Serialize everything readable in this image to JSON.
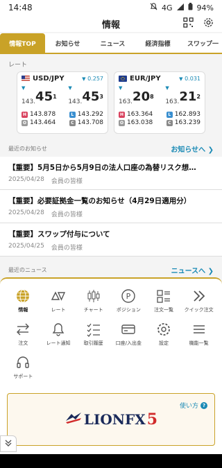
{
  "status": {
    "time": "14:48",
    "network": "4G",
    "battery": "94%"
  },
  "header": {
    "title": "情報"
  },
  "tabs": [
    {
      "label": "情報TOP",
      "active": true
    },
    {
      "label": "お知らせ"
    },
    {
      "label": "ニュース"
    },
    {
      "label": "経済指標"
    },
    {
      "label": "スワップ一"
    }
  ],
  "rates_section": {
    "label": "レート"
  },
  "rates": [
    {
      "pair": "USD/JPY",
      "change": "0.257",
      "bid": {
        "small": "143.",
        "big": "45",
        "sup": "1"
      },
      "ask": {
        "small": "143.",
        "big": "45",
        "sup": "3"
      },
      "high": "143.878",
      "low": "143.292",
      "open": "143.464",
      "close": "143.708"
    },
    {
      "pair": "EUR/JPY",
      "change": "0.031",
      "bid": {
        "small": "163.",
        "big": "20",
        "sup": "8"
      },
      "ask": {
        "small": "163.",
        "big": "21",
        "sup": "2"
      },
      "high": "163.364",
      "low": "162.893",
      "open": "163.038",
      "close": "163.239"
    }
  ],
  "notices": {
    "label": "最近のお知らせ",
    "link": "お知らせへ ❯",
    "items": [
      {
        "title": "【重要】5月5日から5月9日の法人口座の為替リスク想…",
        "date": "2025/04/28",
        "audience": "会員の皆様"
      },
      {
        "title": "【重要】必要証拠金一覧のお知らせ（4月29日適用分）",
        "date": "2025/04/28",
        "audience": "会員の皆様"
      },
      {
        "title": "【重要】スワップ付与について",
        "date": "2025/04/25",
        "audience": "会員の皆様"
      }
    ]
  },
  "news": {
    "label": "最近のニュース",
    "link": "ニュースへ ❯"
  },
  "menu": [
    {
      "label": "情報",
      "icon": "globe-icon",
      "active": true
    },
    {
      "label": "レート",
      "icon": "rate-triangles-icon"
    },
    {
      "label": "チャート",
      "icon": "candlestick-icon"
    },
    {
      "label": "ポジション",
      "icon": "position-p-icon"
    },
    {
      "label": "注文一覧",
      "icon": "order-list-icon"
    },
    {
      "label": "クイック注文",
      "icon": "double-chevron-icon"
    },
    {
      "label": "注文",
      "icon": "exchange-arrows-icon"
    },
    {
      "label": "レート通知",
      "icon": "bell-icon"
    },
    {
      "label": "取引履歴",
      "icon": "checklist-icon"
    },
    {
      "label": "口座/入出金",
      "icon": "card-icon"
    },
    {
      "label": "設定",
      "icon": "gear-icon"
    },
    {
      "label": "機能一覧",
      "icon": "menu-icon"
    },
    {
      "label": "サポート",
      "icon": "headset-icon"
    }
  ],
  "banner": {
    "logo_text": "LIONFX",
    "logo_number": "5",
    "howto": "使い方",
    "help_symbol": "?"
  },
  "colors": {
    "accent": "#c9a227",
    "link": "#1a8ab5",
    "down": "#1a8ab5"
  }
}
